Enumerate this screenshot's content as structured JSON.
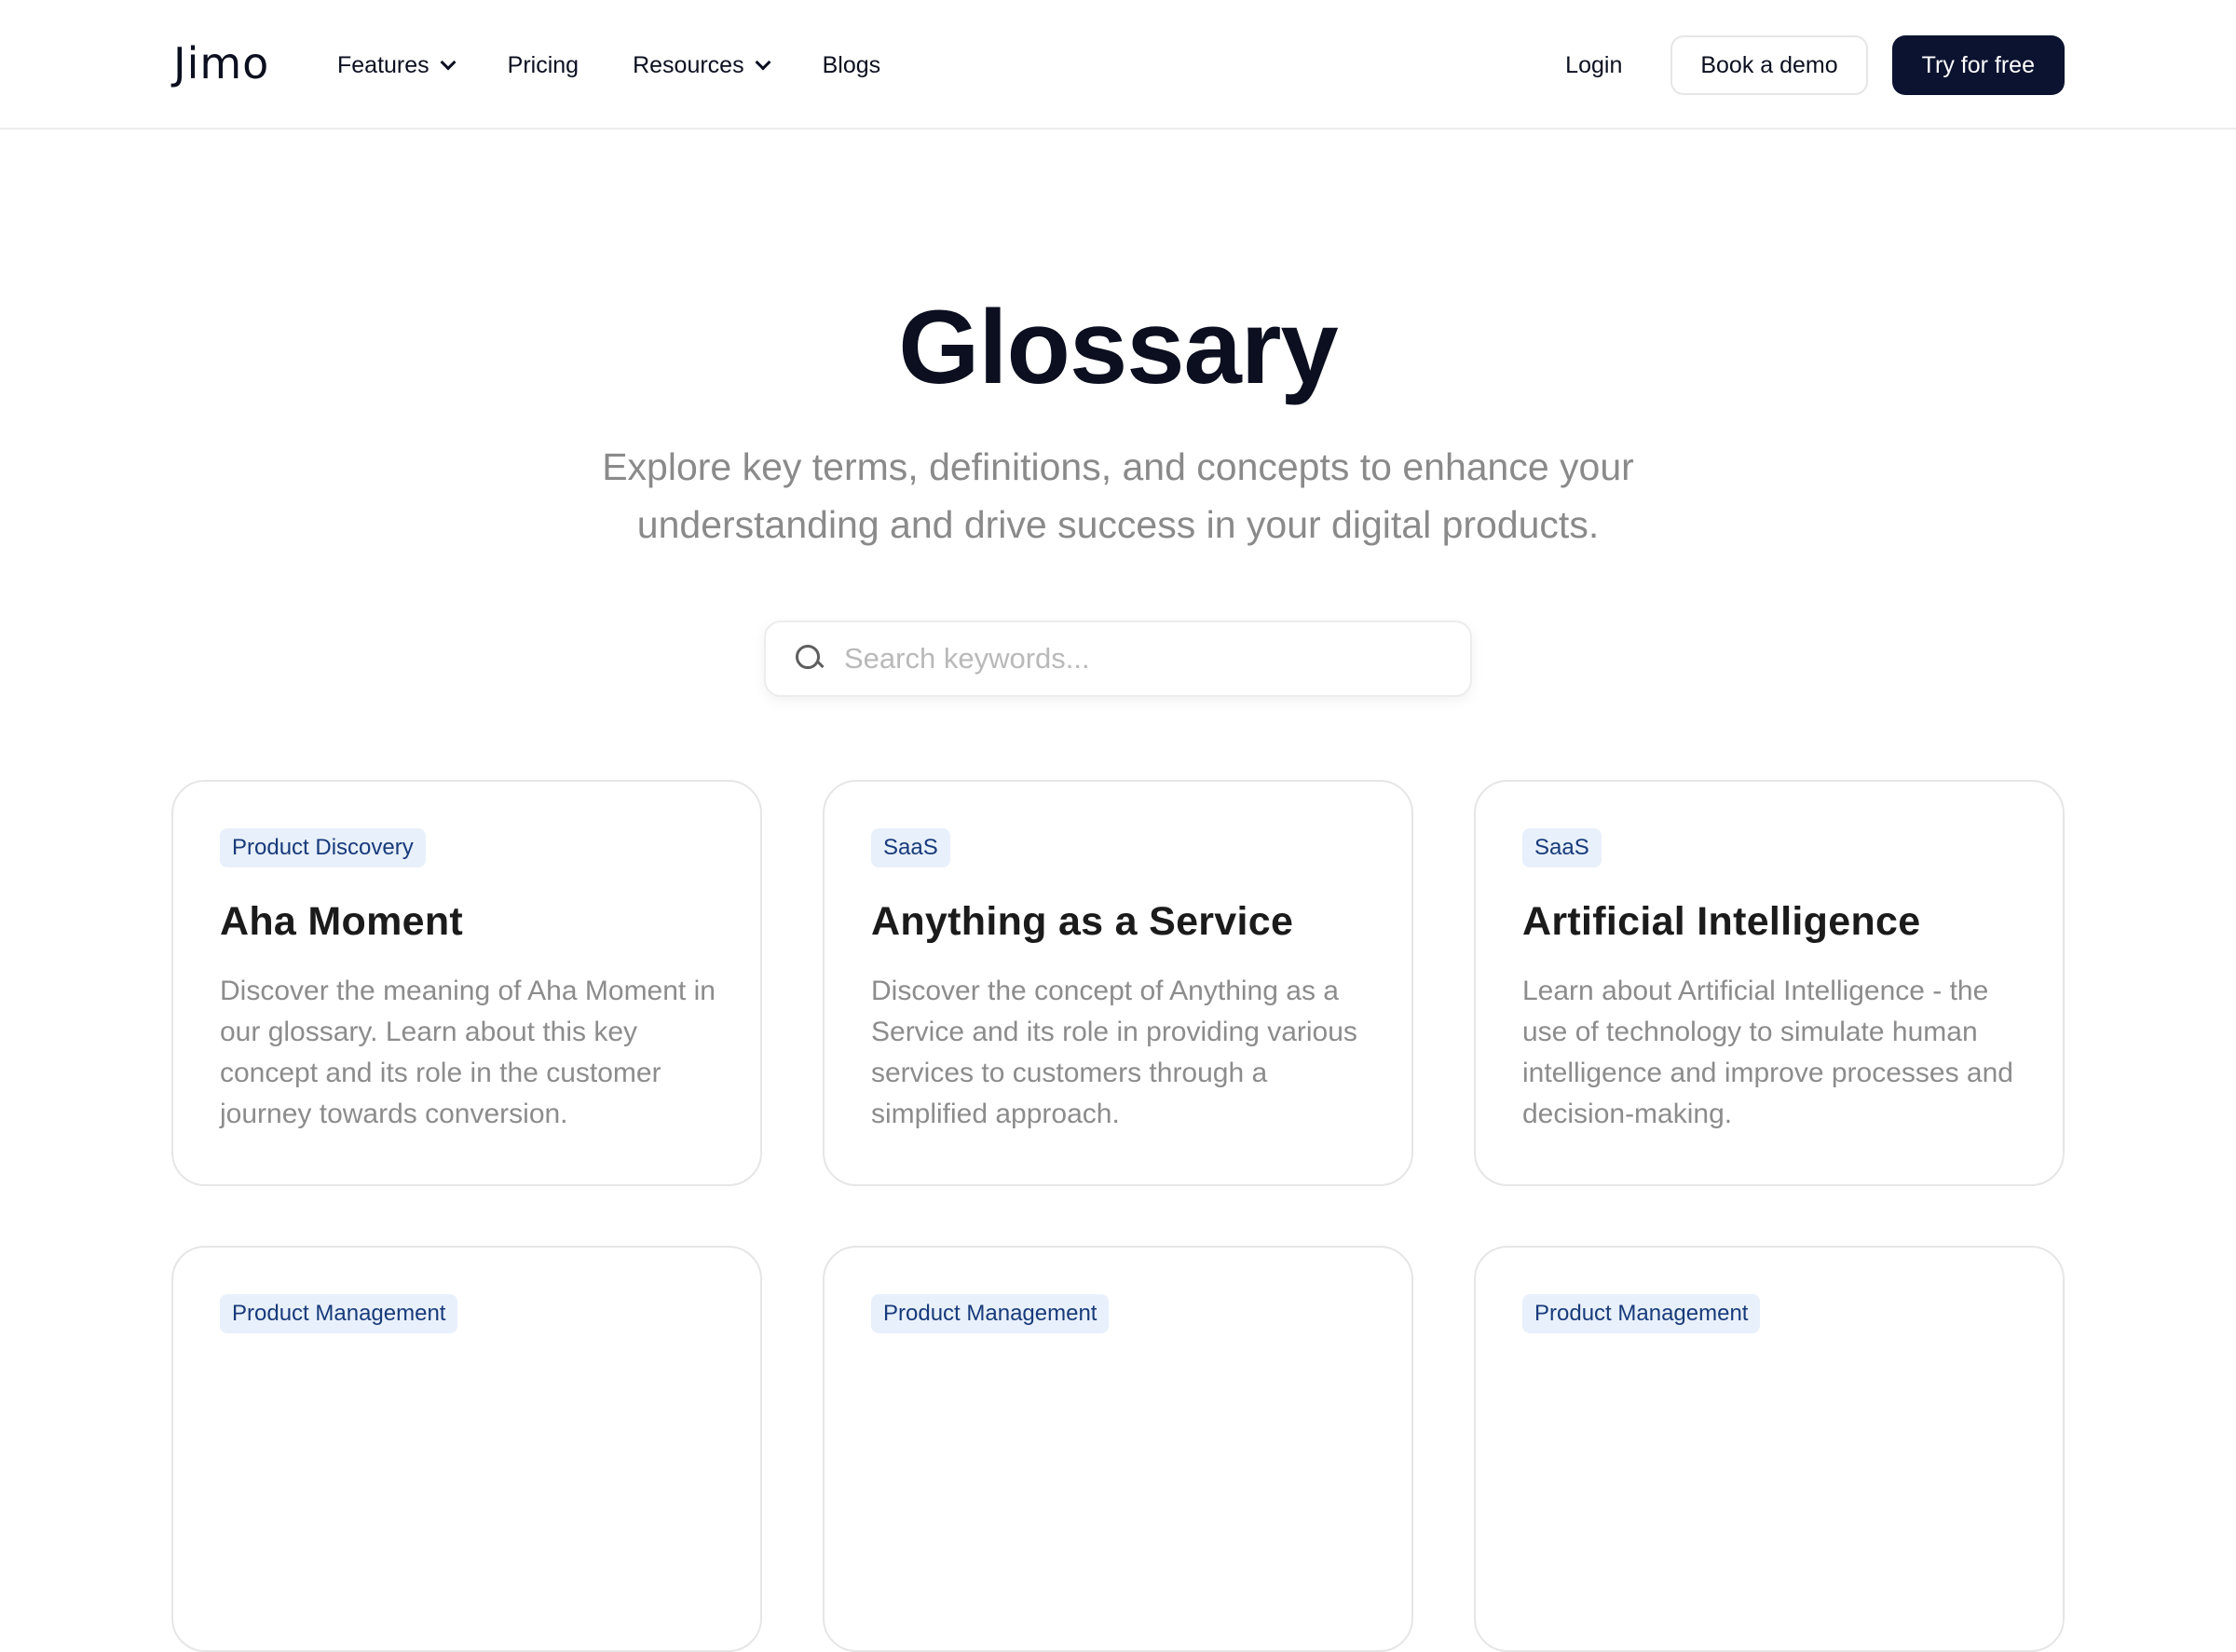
{
  "nav": {
    "logo": "Jimo",
    "links": [
      {
        "label": "Features",
        "has_dropdown": true
      },
      {
        "label": "Pricing",
        "has_dropdown": false
      },
      {
        "label": "Resources",
        "has_dropdown": true
      },
      {
        "label": "Blogs",
        "has_dropdown": false
      }
    ],
    "login": "Login",
    "book_demo": "Book a demo",
    "try_free": "Try for free"
  },
  "hero": {
    "title": "Glossary",
    "subtitle": "Explore key terms, definitions, and concepts to enhance your understanding and drive success in your digital products."
  },
  "search": {
    "placeholder": "Search keywords...",
    "value": "",
    "icon": "search-icon"
  },
  "cards": [
    {
      "tag": "Product Discovery",
      "title": "Aha Moment",
      "description": "Discover the meaning of Aha Moment in our glossary. Learn about this key concept and its role in the customer journey towards conversion."
    },
    {
      "tag": "SaaS",
      "title": "Anything as a Service",
      "description": "Discover the concept of Anything as a Service and its role in providing various services to customers through a simplified approach."
    },
    {
      "tag": "SaaS",
      "title": "Artificial Intelligence",
      "description": "Learn about Artificial Intelligence - the use of technology to simulate human intelligence and improve processes and decision-making."
    },
    {
      "tag": "Product Management",
      "title": "",
      "description": ""
    },
    {
      "tag": "Product Management",
      "title": "",
      "description": ""
    },
    {
      "tag": "Product Management",
      "title": "",
      "description": ""
    }
  ],
  "colors": {
    "primary_button": "#0c1330",
    "tag_background": "#e8f0fb",
    "tag_text": "#173a7a",
    "muted_text": "#8a8a8a"
  }
}
